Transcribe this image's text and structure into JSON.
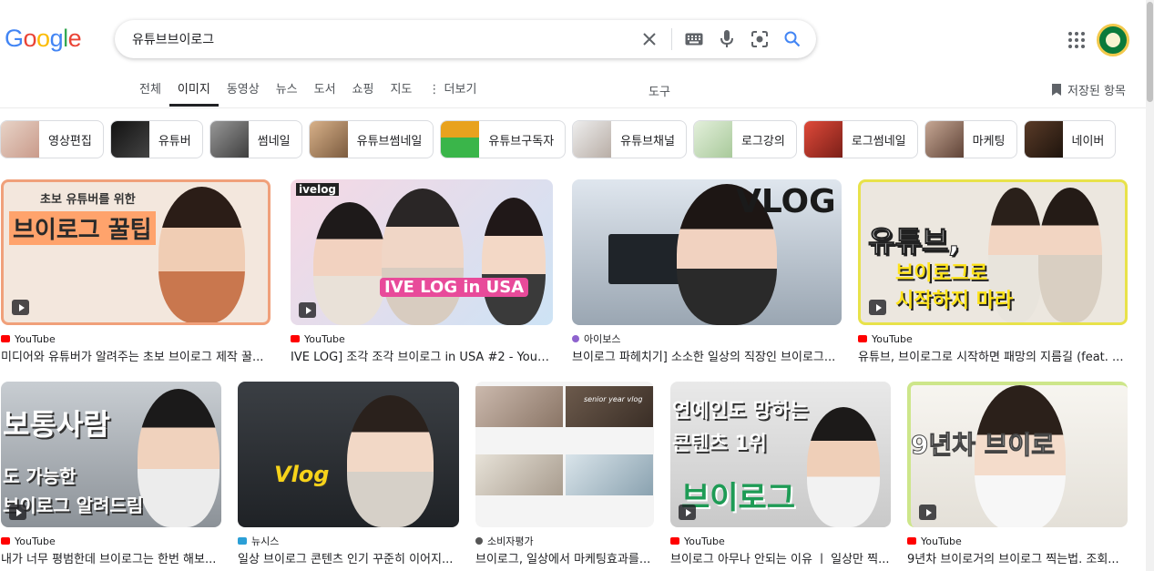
{
  "header": {
    "logo": [
      "G",
      "o",
      "o",
      "g",
      "l",
      "e"
    ],
    "query": "유튜브브이로그",
    "icons": [
      "clear-icon",
      "keyboard-icon",
      "microphone-icon",
      "lens-icon",
      "search-icon"
    ]
  },
  "tabs": [
    {
      "label": "전체"
    },
    {
      "label": "이미지",
      "active": true
    },
    {
      "label": "동영상"
    },
    {
      "label": "뉴스"
    },
    {
      "label": "도서"
    },
    {
      "label": "쇼핑"
    },
    {
      "label": "지도"
    },
    {
      "label": "⋮ 더보기"
    }
  ],
  "tools_label": "도구",
  "saved_label": "저장된 항목",
  "chips": [
    {
      "label": "영상편집",
      "color": "#d9c3b5"
    },
    {
      "label": "유튜버",
      "color": "#1f1f1f"
    },
    {
      "label": "썸네일",
      "color": "#6b6b6b"
    },
    {
      "label": "유튜브썸네일",
      "color": "#b98a5e"
    },
    {
      "label": "유튜브구독자",
      "color": "#e8a21e"
    },
    {
      "label": "유튜브채널",
      "color": "#d7d2cc"
    },
    {
      "label": "로그강의",
      "color": "#cfe3c9"
    },
    {
      "label": "로그썸네일",
      "color": "#e04a3a"
    },
    {
      "label": "마케팅",
      "color": "#8c6b5a"
    },
    {
      "label": "네이버",
      "color": "#3b2b20"
    }
  ],
  "results": [
    {
      "source": "YouTube",
      "source_color": "#ff0000",
      "title": "미디어와 유튜버가 알려주는 초보 브이로그 제작 꿀...",
      "overlay": "브이로그 꿀팁",
      "overlay2": "초보 유튜버를 위한"
    },
    {
      "source": "YouTube",
      "source_color": "#ff0000",
      "title": "IVE LOG] 조각 조각 브이로그 in USA #2 - YouTube",
      "overlay": "IVE LOG in USA",
      "overlay2": "ivelog"
    },
    {
      "source": "아이보스",
      "source_color": "#8e63ce",
      "title": "브이로그 파헤치기] 소소한 일상의 직장인 브이로그...",
      "overlay": "VLOG"
    },
    {
      "source": "YouTube",
      "source_color": "#ff0000",
      "title": "유튜브, 브이로그로 시작하면 패망의 지름길 (feat. ...",
      "overlay": "유튜브,",
      "overlay2": "브이로그로",
      "overlay3": "시작하지 마라"
    },
    {
      "source": "YouTube",
      "source_color": "#ff0000",
      "title": "내가 너무 평범한데 브이로그는 한번 해보...",
      "overlay": "보통사람",
      "overlay2": "도 가능한",
      "overlay3": "브이로그 알려드림"
    },
    {
      "source": "뉴시스",
      "source_color": "#2b9fd6",
      "title": "일상 브이로그 콘텐츠 인기 꾸준히 이어지...",
      "overlay": "Vlog"
    },
    {
      "source": "소비자평가",
      "source_color": "#555555",
      "title": "브이로그, 일상에서 마케팅효과를...",
      "overlay": "senior year vlog"
    },
    {
      "source": "YouTube",
      "source_color": "#ff0000",
      "title": "브이로그 아무나 안되는 이유 ㅣ 일상만 찍...",
      "overlay": "연예인도 망하는",
      "overlay2": "콘텐츠 1위",
      "overlay3": "브이로그"
    },
    {
      "source": "YouTube",
      "source_color": "#ff0000",
      "title": "9년차 브이로거의 브이로그 찍는법. 조회...",
      "overlay": "9년차 브이로"
    }
  ]
}
